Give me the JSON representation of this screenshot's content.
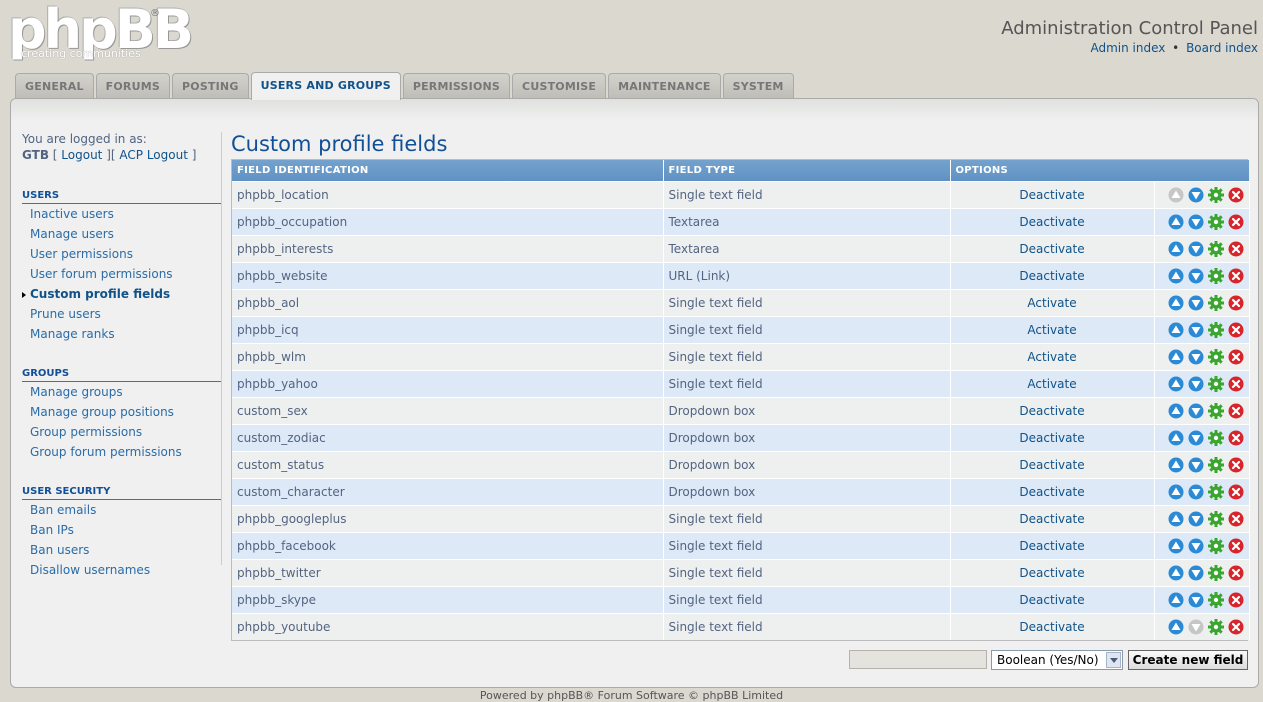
{
  "header": {
    "logo_text": "phpBB",
    "logo_tagline": "creating communities",
    "logo_registered": "®",
    "title": "Administration Control Panel",
    "links": [
      "Admin index",
      "Board index"
    ],
    "link_separator": "•"
  },
  "tabs": [
    {
      "label": "GENERAL"
    },
    {
      "label": "FORUMS"
    },
    {
      "label": "POSTING"
    },
    {
      "label": "USERS AND GROUPS",
      "active": true
    },
    {
      "label": "PERMISSIONS"
    },
    {
      "label": "CUSTOMISE"
    },
    {
      "label": "MAINTENANCE"
    },
    {
      "label": "SYSTEM"
    }
  ],
  "sidebar": {
    "logged_in_label": "You are logged in as:",
    "username": "GTB",
    "logout": "Logout",
    "acp_logout": "ACP Logout",
    "sections": [
      {
        "heading": "USERS",
        "items": [
          {
            "label": "Inactive users"
          },
          {
            "label": "Manage users"
          },
          {
            "label": "User permissions"
          },
          {
            "label": "User forum permissions"
          },
          {
            "label": "Custom profile fields",
            "active": true
          },
          {
            "label": "Prune users"
          },
          {
            "label": "Manage ranks"
          }
        ]
      },
      {
        "heading": "GROUPS",
        "items": [
          {
            "label": "Manage groups"
          },
          {
            "label": "Manage group positions"
          },
          {
            "label": "Group permissions"
          },
          {
            "label": "Group forum permissions"
          }
        ]
      },
      {
        "heading": "USER SECURITY",
        "items": [
          {
            "label": "Ban emails"
          },
          {
            "label": "Ban IPs"
          },
          {
            "label": "Ban users"
          },
          {
            "label": "Disallow usernames"
          }
        ]
      }
    ]
  },
  "main": {
    "title": "Custom profile fields",
    "columns": [
      "FIELD IDENTIFICATION",
      "FIELD TYPE",
      "OPTIONS"
    ],
    "rows": [
      {
        "id": "phpbb_location",
        "type": "Single text field",
        "option": "Deactivate",
        "up_disabled": true,
        "down_disabled": false
      },
      {
        "id": "phpbb_occupation",
        "type": "Textarea",
        "option": "Deactivate",
        "up_disabled": false,
        "down_disabled": false
      },
      {
        "id": "phpbb_interests",
        "type": "Textarea",
        "option": "Deactivate",
        "up_disabled": false,
        "down_disabled": false
      },
      {
        "id": "phpbb_website",
        "type": "URL (Link)",
        "option": "Deactivate",
        "up_disabled": false,
        "down_disabled": false
      },
      {
        "id": "phpbb_aol",
        "type": "Single text field",
        "option": "Activate",
        "up_disabled": false,
        "down_disabled": false
      },
      {
        "id": "phpbb_icq",
        "type": "Single text field",
        "option": "Activate",
        "up_disabled": false,
        "down_disabled": false
      },
      {
        "id": "phpbb_wlm",
        "type": "Single text field",
        "option": "Activate",
        "up_disabled": false,
        "down_disabled": false
      },
      {
        "id": "phpbb_yahoo",
        "type": "Single text field",
        "option": "Activate",
        "up_disabled": false,
        "down_disabled": false
      },
      {
        "id": "custom_sex",
        "type": "Dropdown box",
        "option": "Deactivate",
        "up_disabled": false,
        "down_disabled": false
      },
      {
        "id": "custom_zodiac",
        "type": "Dropdown box",
        "option": "Deactivate",
        "up_disabled": false,
        "down_disabled": false
      },
      {
        "id": "custom_status",
        "type": "Dropdown box",
        "option": "Deactivate",
        "up_disabled": false,
        "down_disabled": false
      },
      {
        "id": "custom_character",
        "type": "Dropdown box",
        "option": "Deactivate",
        "up_disabled": false,
        "down_disabled": false
      },
      {
        "id": "phpbb_googleplus",
        "type": "Single text field",
        "option": "Deactivate",
        "up_disabled": false,
        "down_disabled": false
      },
      {
        "id": "phpbb_facebook",
        "type": "Single text field",
        "option": "Deactivate",
        "up_disabled": false,
        "down_disabled": false
      },
      {
        "id": "phpbb_twitter",
        "type": "Single text field",
        "option": "Deactivate",
        "up_disabled": false,
        "down_disabled": false
      },
      {
        "id": "phpbb_skype",
        "type": "Single text field",
        "option": "Deactivate",
        "up_disabled": false,
        "down_disabled": false
      },
      {
        "id": "phpbb_youtube",
        "type": "Single text field",
        "option": "Deactivate",
        "up_disabled": false,
        "down_disabled": true
      }
    ],
    "new_field_name_value": "",
    "field_type_select": "Boolean (Yes/No)",
    "create_button": "Create new field"
  },
  "icons": {
    "move_up": "arrow-up-icon",
    "move_down": "arrow-down-icon",
    "edit": "gear-icon",
    "delete": "delete-icon"
  },
  "colors": {
    "accent_blue": "#105289",
    "header_blue": "#6a9cc9",
    "row_alt": "#dde9f7",
    "edit_green": "#3aa62f",
    "delete_red": "#d8242b",
    "arrow_blue": "#2b8ad6"
  },
  "footer": {
    "text": "Powered by phpBB® Forum Software © phpBB Limited"
  }
}
